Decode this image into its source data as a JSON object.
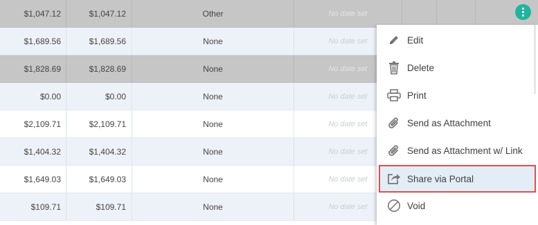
{
  "table": {
    "rows": [
      {
        "amount": "$1,047.12",
        "balance": "$1,047.12",
        "status": "Other",
        "date": "No date set"
      },
      {
        "amount": "$1,689.56",
        "balance": "$1,689.56",
        "status": "None",
        "date": "No date set"
      },
      {
        "amount": "$1,828.69",
        "balance": "$1,828.69",
        "status": "None",
        "date": "No date set"
      },
      {
        "amount": "$0.00",
        "balance": "$0.00",
        "status": "None",
        "date": "No date set"
      },
      {
        "amount": "$2,109.71",
        "balance": "$2,109.71",
        "status": "None",
        "date": "No date set"
      },
      {
        "amount": "$1,404.32",
        "balance": "$1,404.32",
        "status": "None",
        "date": "No date set"
      },
      {
        "amount": "$1,649.03",
        "balance": "$1,649.03",
        "status": "None",
        "date": "No date set"
      },
      {
        "amount": "$109.71",
        "balance": "$109.71",
        "status": "None",
        "date": "No date set"
      }
    ]
  },
  "menu": {
    "items": [
      {
        "label": "Edit",
        "icon": "pencil-icon"
      },
      {
        "label": "Delete",
        "icon": "trash-icon"
      },
      {
        "label": "Print",
        "icon": "printer-icon"
      },
      {
        "label": "Send as Attachment",
        "icon": "paperclip-icon"
      },
      {
        "label": "Send as Attachment w/ Link",
        "icon": "paperclip-icon"
      },
      {
        "label": "Share via Portal",
        "icon": "share-icon"
      },
      {
        "label": "Void",
        "icon": "void-icon"
      }
    ]
  },
  "colors": {
    "accent": "#20b49c",
    "highlight_border": "#e24c4c",
    "selected_row": "#c6c6c6",
    "alt_row": "#edf2f8"
  }
}
